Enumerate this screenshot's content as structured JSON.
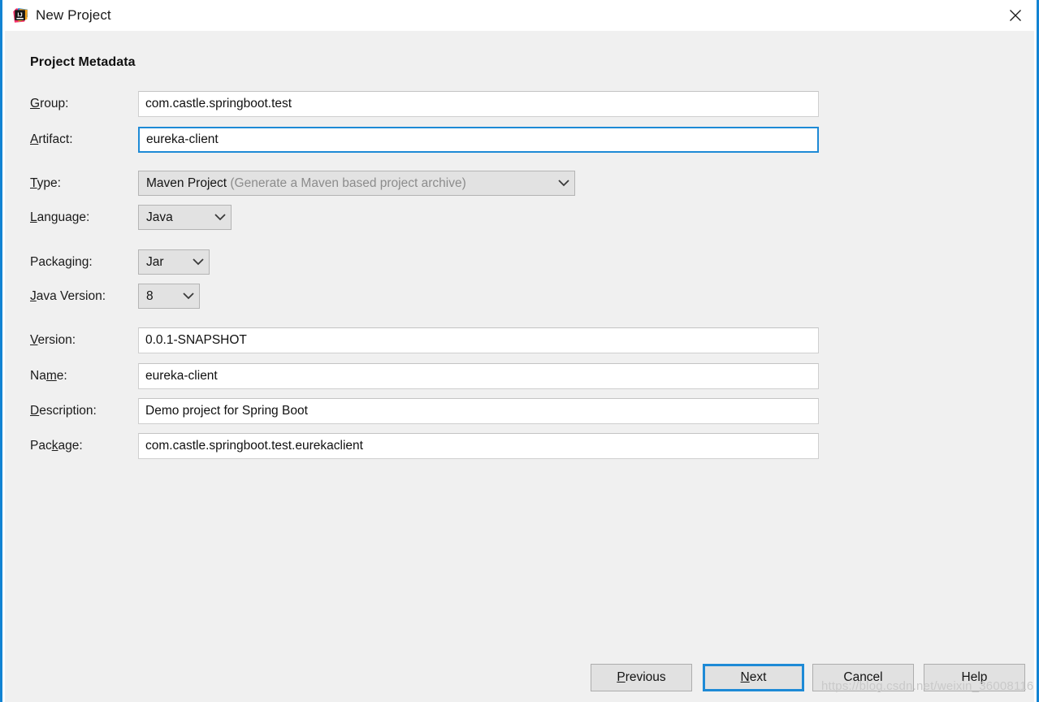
{
  "window": {
    "title": "New Project",
    "icon": "intellij-idea-logo",
    "close_label": "✕",
    "accent_color": "#1283d3",
    "background": "#f0f0f0"
  },
  "section": {
    "title": "Project Metadata"
  },
  "fields": [
    {
      "key": "group",
      "label_pre": "",
      "label_mnemonic": "G",
      "label_post": "roup:",
      "label": "Group:",
      "value": "com.castle.springboot.test",
      "type": "text",
      "focused": false
    },
    {
      "key": "artifact",
      "label_pre": "",
      "label_mnemonic": "A",
      "label_post": "rtifact:",
      "label": "Artifact:",
      "value": "eureka-client",
      "type": "text",
      "focused": true
    },
    {
      "key": "type",
      "label_pre": "",
      "label_mnemonic": "T",
      "label_post": "ype:",
      "label": "Type:",
      "value": "Maven Project",
      "value_hint": "(Generate a Maven based project archive)",
      "type": "combo",
      "focused": false
    },
    {
      "key": "language",
      "label_pre": "",
      "label_mnemonic": "L",
      "label_post": "anguage:",
      "label": "Language:",
      "value": "Java",
      "type": "combo",
      "focused": false
    },
    {
      "key": "packaging",
      "label_pre": "Packa",
      "label_mnemonic": "g",
      "label_post": "ing:",
      "label": "Packaging:",
      "value": "Jar",
      "type": "combo",
      "focused": false
    },
    {
      "key": "java_version",
      "label_pre": "",
      "label_mnemonic": "J",
      "label_post": "ava Version:",
      "label": "Java Version:",
      "value": "8",
      "type": "combo",
      "focused": false
    },
    {
      "key": "version",
      "label_pre": "",
      "label_mnemonic": "V",
      "label_post": "ersion:",
      "label": "Version:",
      "value": "0.0.1-SNAPSHOT",
      "type": "text",
      "focused": false
    },
    {
      "key": "name",
      "label_pre": "Na",
      "label_mnemonic": "m",
      "label_post": "e:",
      "label": "Name:",
      "value": "eureka-client",
      "type": "text",
      "focused": false
    },
    {
      "key": "description",
      "label_pre": "",
      "label_mnemonic": "D",
      "label_post": "escription:",
      "label": "Description:",
      "value": "Demo project for Spring Boot",
      "type": "text",
      "focused": false
    },
    {
      "key": "package",
      "label_pre": "Pac",
      "label_mnemonic": "k",
      "label_post": "age:",
      "label": "Package:",
      "value": "com.castle.springboot.test.eurekaclient",
      "type": "text",
      "focused": false
    }
  ],
  "footer": {
    "buttons": [
      {
        "key": "previous",
        "pre": "",
        "mnemonic": "P",
        "post": "revious",
        "label": "Previous",
        "default": false
      },
      {
        "key": "next",
        "pre": "",
        "mnemonic": "N",
        "post": "ext",
        "label": "Next",
        "default": true
      },
      {
        "key": "cancel",
        "pre": "Cancel",
        "mnemonic": "",
        "post": "",
        "label": "Cancel",
        "default": false
      },
      {
        "key": "help",
        "pre": "Help",
        "mnemonic": "",
        "post": "",
        "label": "Help",
        "default": false
      }
    ]
  },
  "watermark": {
    "text": "https://blog.csdn.net/weixin_36008116"
  }
}
